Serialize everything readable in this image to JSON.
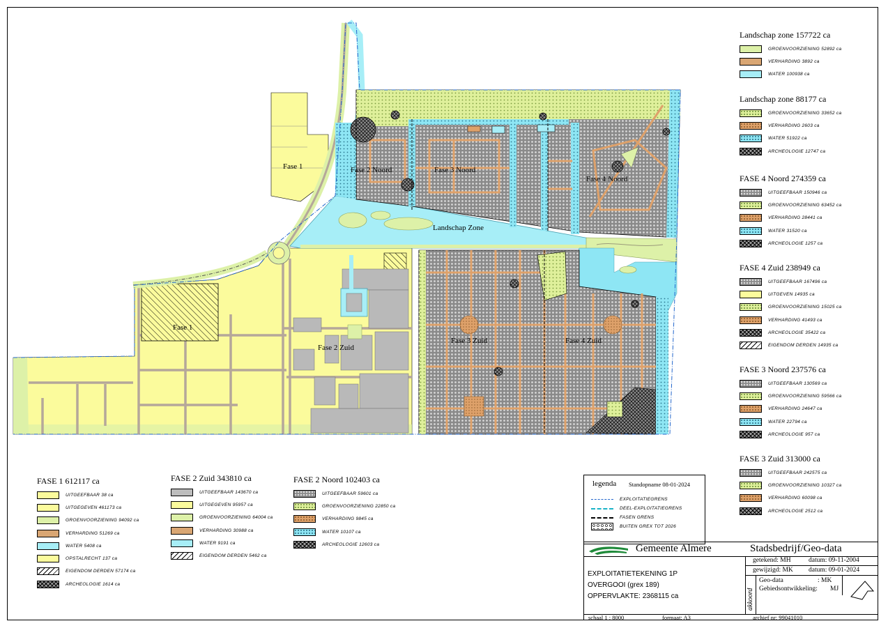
{
  "legends_left": [
    {
      "title": "FASE 1  612117 ca",
      "items": [
        {
          "label": "UITGEEFBAAR 38 ca",
          "pattern": "uitg"
        },
        {
          "label": "UITGEGEVEN 461173 ca",
          "pattern": "uitg"
        },
        {
          "label": "GROENVOORZIENING 94092 ca",
          "pattern": "groen"
        },
        {
          "label": "VERHARDING 51269 ca",
          "pattern": "verh"
        },
        {
          "label": "WATER 5408 ca",
          "pattern": "water"
        },
        {
          "label": "OPSTALRECHT 137 ca",
          "pattern": "uitg"
        },
        {
          "label": "EIGENDOM DERDEN 57174 ca",
          "pattern": "eig"
        },
        {
          "label": "ARCHEOLOGIE 1614 ca",
          "pattern": "arch"
        }
      ]
    },
    {
      "title": "FASE 2 Zuid  343810 ca",
      "items": [
        {
          "label": "UITGEEFBAAR 143670 ca",
          "pattern": "uitplain"
        },
        {
          "label": "UITGEGEVEN 95957  ca",
          "pattern": "uitg"
        },
        {
          "label": "GROENVOORZIENING 64004 ca",
          "pattern": "groen"
        },
        {
          "label": "VERHARDING 30988 ca",
          "pattern": "verh"
        },
        {
          "label": "WATER 9191 ca",
          "pattern": "water"
        },
        {
          "label": "EIGENDOM DERDEN 5462 ca",
          "pattern": "eig"
        }
      ]
    },
    {
      "title": "FASE 2 Noord  102403 ca",
      "items": [
        {
          "label": "UITGEEFBAAR 59601 ca",
          "pattern": "uit"
        },
        {
          "label": "GROENVOORZIENING 22850 ca",
          "pattern": "groend"
        },
        {
          "label": "VERHARDING 9845 ca",
          "pattern": "verhd"
        },
        {
          "label": "WATER 10107 ca",
          "pattern": "waterd"
        },
        {
          "label": "ARCHEOLOGIE 12603 ca",
          "pattern": "arch"
        }
      ]
    }
  ],
  "legends_right": [
    {
      "title": "Landschap zone 157722 ca",
      "items": [
        {
          "label": "GROENVOORZIENING 52892 ca",
          "pattern": "groen"
        },
        {
          "label": "VERHARDING 3892 ca",
          "pattern": "verh"
        },
        {
          "label": "WATER 100938 ca",
          "pattern": "water"
        }
      ]
    },
    {
      "title": "Landschap zone 88177 ca",
      "items": [
        {
          "label": "GROENVOORZIENING 33652 ca",
          "pattern": "groend"
        },
        {
          "label": "VERHARDING 2603 ca",
          "pattern": "verhd"
        },
        {
          "label": "WATER 51922 ca",
          "pattern": "waterd"
        },
        {
          "label": "ARCHEOLOGIE 12747 ca",
          "pattern": "arch"
        }
      ]
    },
    {
      "title": "FASE 4 Noord  274359 ca",
      "items": [
        {
          "label": "UITGEEFBAAR 150946 ca",
          "pattern": "uit"
        },
        {
          "label": "GROENVOORZIENING 63452 ca",
          "pattern": "groend"
        },
        {
          "label": "VERHARDING 28441 ca",
          "pattern": "verhd"
        },
        {
          "label": "WATER 31520 ca",
          "pattern": "waterd"
        },
        {
          "label": "ARCHEOLOGIE 1257 ca",
          "pattern": "arch"
        }
      ]
    },
    {
      "title": "FASE 4 Zuid  238949 ca",
      "items": [
        {
          "label": "UITGEEFBAAR 167496 ca",
          "pattern": "uit"
        },
        {
          "label": "UITGEVEN 14935 ca",
          "pattern": "uitg"
        },
        {
          "label": "GROENVOORZIENING 15025 ca",
          "pattern": "groend"
        },
        {
          "label": "VERHARDING 41493 ca",
          "pattern": "verhd"
        },
        {
          "label": "ARCHEOLOGIE 35422 ca",
          "pattern": "arch"
        },
        {
          "label": "EIGENDOM DERDEN 14935 ca",
          "pattern": "eig"
        }
      ]
    },
    {
      "title": "FASE 3 Noord  237576 ca",
      "items": [
        {
          "label": "UITGEEFBAAR 130569 ca",
          "pattern": "uit"
        },
        {
          "label": "GROENVOORZIENING 59566 ca",
          "pattern": "groend"
        },
        {
          "label": "VERHARDING 24647 ca",
          "pattern": "verhd"
        },
        {
          "label": "WATER 22794 ca",
          "pattern": "waterd"
        },
        {
          "label": "ARCHEOLOGIE 957 ca",
          "pattern": "arch"
        }
      ]
    },
    {
      "title": "FASE 3 Zuid  313000 ca",
      "items": [
        {
          "label": "UITGEEFBAAR 242575 ca",
          "pattern": "uit"
        },
        {
          "label": "GROENVOORZIENING 10327 ca",
          "pattern": "groend"
        },
        {
          "label": "VERHARDING 60098 ca",
          "pattern": "verhd"
        },
        {
          "label": "ARCHEOLOGIE 2512 ca",
          "pattern": "arch"
        }
      ]
    }
  ],
  "legenda": {
    "title": "legenda",
    "date": "Standopname 08-01-2024",
    "items": [
      {
        "label": "EXPLOITATIEGRENS",
        "style": "dashdot-blue"
      },
      {
        "label": "DEEL-EXPLOITATIEGRENS",
        "style": "dash-cyan"
      },
      {
        "label": "FASEN GRENS",
        "style": "dash-black"
      },
      {
        "label": "BUITEN GREX TOT 2026",
        "style": "circles"
      }
    ]
  },
  "map_labels": {
    "fase1_north": "Fase 1",
    "fase1_south": "Fase 1",
    "fase2_noord": "Fase 2 Noord",
    "fase3_noord": "Fase 3 Noord",
    "fase4_noord": "Fase 4 Noord",
    "landschap": "Landschap Zone",
    "fase2_zuid": "Fase 2 Zuid",
    "fase3_zuid": "Fase 3 Zuid",
    "fase4_zuid": "Fase 4 Zuid"
  },
  "title_block": {
    "org": "Gemeente Almere",
    "dept": "Stadsbedrijf/Geo-data",
    "getekend": "getekend:  MH",
    "getekend_datum": "datum:  09-11-2004",
    "gewijzigd": "gewijzigd:  MK",
    "gewijzigd_datum": "datum:  09-01-2024",
    "line1": "EXPLOITATIETEKENING  1P",
    "line2": "OVERGOOI  (grex 189)",
    "line3": "OPPERVLAKTE:  2368115 ca",
    "akkoord": "akkoord",
    "geodata_label": "Geo-data",
    "geodata_val": ":   MK",
    "gebied_label": "Gebiedsontwikkeling:",
    "gebied_val": "MJ",
    "schaal": "schaal     1 : 8000",
    "formaat": "formaat:  A3",
    "archief": "archief nr: 99041010"
  },
  "colors": {
    "uitgegeven": "#fbfb9c",
    "uitgeefbaar": "#8c8c8c",
    "groen": "#ddf1a8",
    "water": "#a7eef7",
    "verharding": "#d9a673",
    "brand_green": "#1f8a3a"
  }
}
